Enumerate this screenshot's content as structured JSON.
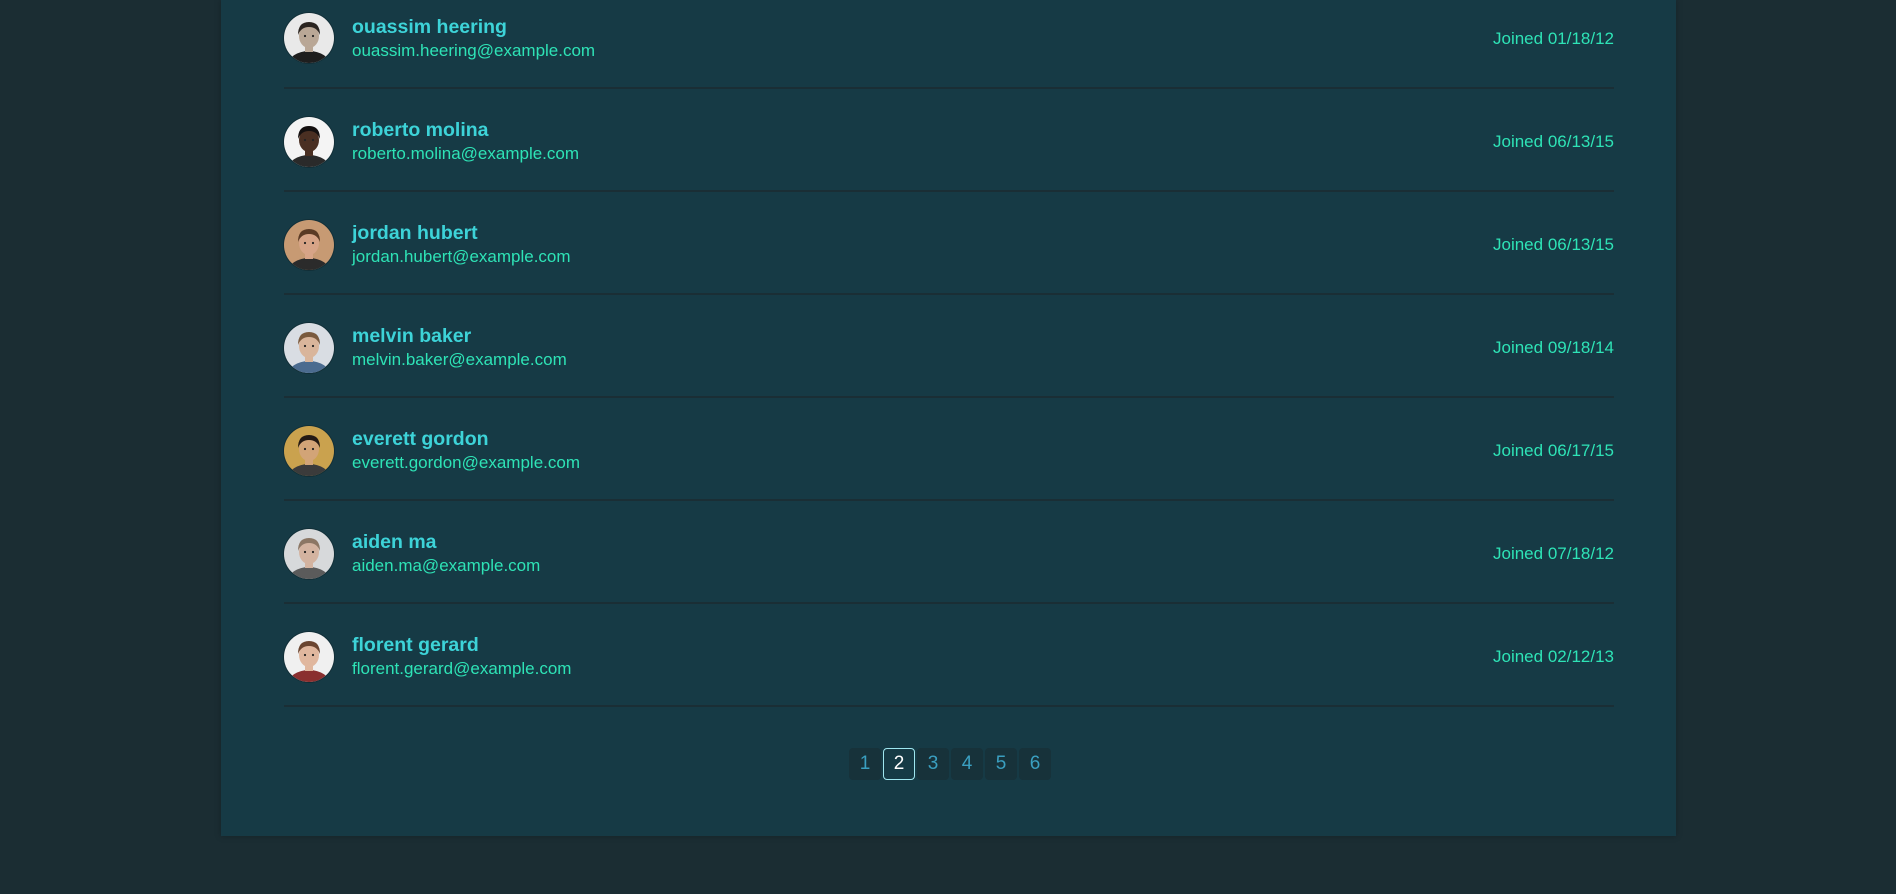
{
  "users": [
    {
      "name": "ouassim heering",
      "email": "ouassim.heering@example.com",
      "joined": "Joined 01/18/12",
      "avatar": {
        "bg": "#e9e9e9",
        "skin": "#b9a796",
        "hair": "#2a2420",
        "shirt": "#1e1e1e"
      }
    },
    {
      "name": "roberto molina",
      "email": "roberto.molina@example.com",
      "joined": "Joined 06/13/15",
      "avatar": {
        "bg": "#f4f4f4",
        "skin": "#4a2f22",
        "hair": "#141010",
        "shirt": "#2a2a2a"
      }
    },
    {
      "name": "jordan hubert",
      "email": "jordan.hubert@example.com",
      "joined": "Joined 06/13/15",
      "avatar": {
        "bg": "#c79a73",
        "skin": "#d7a487",
        "hair": "#5a3a25",
        "shirt": "#2b2b2b"
      }
    },
    {
      "name": "melvin baker",
      "email": "melvin.baker@example.com",
      "joined": "Joined 09/18/14",
      "avatar": {
        "bg": "#d9dde3",
        "skin": "#d9b59b",
        "hair": "#7a5a3e",
        "shirt": "#4b6b8f"
      }
    },
    {
      "name": "everett gordon",
      "email": "everett.gordon@example.com",
      "joined": "Joined 06/17/15",
      "avatar": {
        "bg": "#caa24e",
        "skin": "#d2a477",
        "hair": "#241a14",
        "shirt": "#3b3b3b"
      }
    },
    {
      "name": "aiden ma",
      "email": "aiden.ma@example.com",
      "joined": "Joined 07/18/12",
      "avatar": {
        "bg": "#d7d9db",
        "skin": "#d3b3a0",
        "hair": "#8b7664",
        "shirt": "#5b5b5b"
      }
    },
    {
      "name": "florent gerard",
      "email": "florent.gerard@example.com",
      "joined": "Joined 02/12/13",
      "avatar": {
        "bg": "#f0f0f0",
        "skin": "#e0b79e",
        "hair": "#6a4530",
        "shirt": "#8a2f2f"
      }
    }
  ],
  "pagination": {
    "pages": [
      "1",
      "2",
      "3",
      "4",
      "5",
      "6"
    ],
    "current": "2"
  },
  "icons": {
    "avatar": "user-avatar-icon"
  },
  "colors": {
    "background": "#1b2d33",
    "panel": "#163a45",
    "name": "#3dd3d8",
    "email": "#2ee3b6",
    "page_text": "#3a9fc0",
    "active_border": "#9fe6ef"
  }
}
